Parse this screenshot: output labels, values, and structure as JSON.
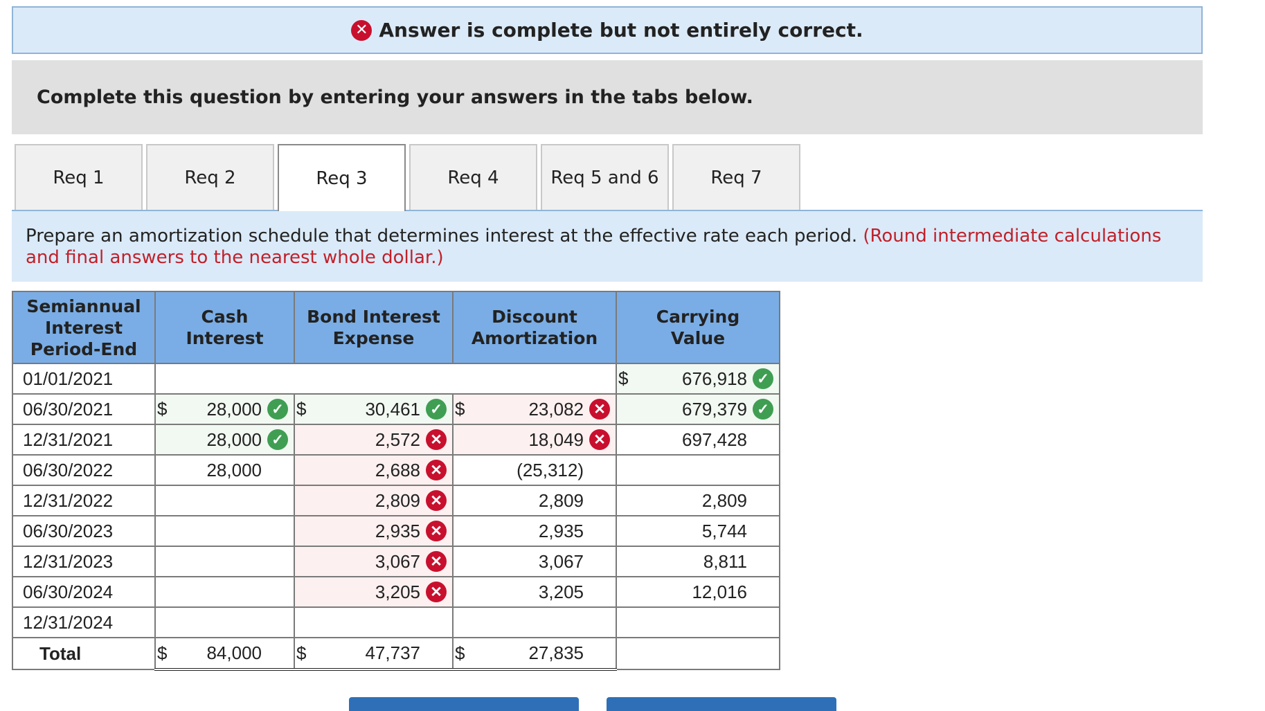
{
  "banner": {
    "text": "Answer is complete but not entirely correct."
  },
  "instructions": "Complete this question by entering your answers in the tabs below.",
  "tabs": [
    {
      "label": "Req 1",
      "active": false
    },
    {
      "label": "Req 2",
      "active": false
    },
    {
      "label": "Req 3",
      "active": true
    },
    {
      "label": "Req 4",
      "active": false
    },
    {
      "label": "Req 5 and 6",
      "active": false
    },
    {
      "label": "Req 7",
      "active": false
    }
  ],
  "prompt": {
    "text": "Prepare an amortization schedule that determines interest at the effective rate each period.",
    "note": "(Round intermediate calculations and final answers to the nearest whole dollar.)"
  },
  "table": {
    "headers": {
      "period": [
        "Semiannual",
        "Interest",
        "Period-End"
      ],
      "cash": [
        "Cash",
        "Interest"
      ],
      "expense": [
        "Bond Interest",
        "Expense"
      ],
      "amort": [
        "Discount",
        "Amortization"
      ],
      "carrying": [
        "Carrying",
        "Value"
      ]
    },
    "rows": [
      {
        "period": "01/01/2021",
        "cash": "",
        "expense": "",
        "amort": "",
        "carrying": "676,918"
      },
      {
        "period": "06/30/2021",
        "cash": "28,000",
        "expense": "30,461",
        "amort": "23,082",
        "carrying": "679,379"
      },
      {
        "period": "12/31/2021",
        "cash": "28,000",
        "expense": "2,572",
        "amort": "18,049",
        "carrying": "697,428"
      },
      {
        "period": "06/30/2022",
        "cash": "28,000",
        "expense": "2,688",
        "amort": "(25,312)",
        "carrying": ""
      },
      {
        "period": "12/31/2022",
        "cash": "",
        "expense": "2,809",
        "amort": "2,809",
        "carrying": "2,809"
      },
      {
        "period": "06/30/2023",
        "cash": "",
        "expense": "2,935",
        "amort": "2,935",
        "carrying": "5,744"
      },
      {
        "period": "12/31/2023",
        "cash": "",
        "expense": "3,067",
        "amort": "3,067",
        "carrying": "8,811"
      },
      {
        "period": "06/30/2024",
        "cash": "",
        "expense": "3,205",
        "amort": "3,205",
        "carrying": "12,016"
      },
      {
        "period": "12/31/2024",
        "cash": "",
        "expense": "",
        "amort": "",
        "carrying": ""
      }
    ],
    "total": {
      "label": "Total",
      "cash": "84,000",
      "expense": "47,737",
      "amort": "27,835"
    },
    "dollar": "$"
  },
  "icons": {
    "correct": "check-icon",
    "incorrect": "x-icon"
  },
  "colors": {
    "header_bg": "#7aade5",
    "banner_bg": "#dbeaf8",
    "correct": "#3f9e52",
    "incorrect": "#c8102e",
    "note": "#c0202a"
  }
}
